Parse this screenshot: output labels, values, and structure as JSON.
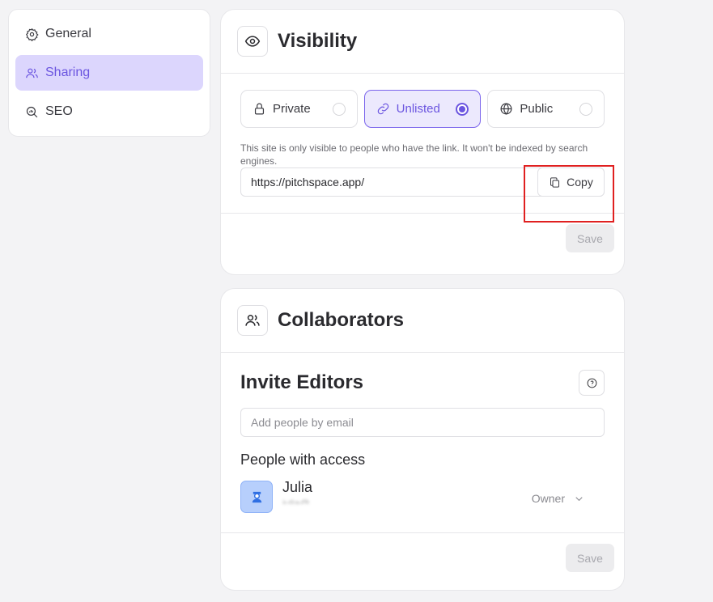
{
  "sidebar": {
    "items": [
      {
        "label": "General",
        "icon": "gear-icon",
        "active": false
      },
      {
        "label": "Sharing",
        "icon": "users-icon",
        "active": true
      },
      {
        "label": "SEO",
        "icon": "seo-search-icon",
        "active": false
      }
    ]
  },
  "visibility": {
    "title": "Visibility",
    "icon": "eye-icon",
    "options": [
      {
        "label": "Private",
        "icon": "lock-icon",
        "selected": false
      },
      {
        "label": "Unlisted",
        "icon": "link-icon",
        "selected": true
      },
      {
        "label": "Public",
        "icon": "globe-icon",
        "selected": false
      }
    ],
    "description": "This site is only visible to people who have the link. It won't be indexed by search engines.",
    "link_value": "https://pitchspace.app/",
    "copy_label": "Copy",
    "save_label": "Save"
  },
  "collaborators": {
    "title": "Collaborators",
    "icon": "users-icon",
    "invite_title": "Invite Editors",
    "email_placeholder": "Add people by email",
    "access_title": "People with access",
    "people": [
      {
        "name": "Julia",
        "email": "julia@...",
        "role": "Owner"
      }
    ],
    "save_label": "Save"
  },
  "colors": {
    "accent": "#6b55e0",
    "accent_bg": "#dcd6fd",
    "highlight_box": "#e02020"
  }
}
